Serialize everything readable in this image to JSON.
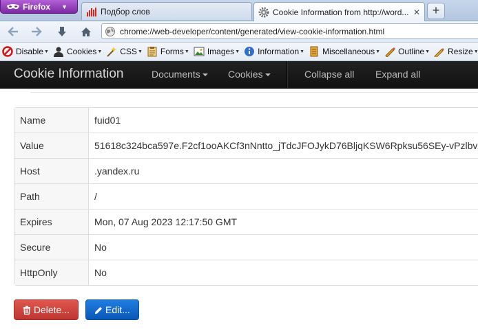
{
  "browser": {
    "app_button": "Firefox",
    "tabs": [
      {
        "title": "Подбор слов",
        "active": false
      },
      {
        "title": "Cookie Information from http://word...",
        "active": true
      }
    ],
    "url": "chrome://web-developer/content/generated/view-cookie-information.html"
  },
  "webdev_toolbar": [
    {
      "label": "Disable",
      "icon": "disable-icon"
    },
    {
      "label": "Cookies",
      "icon": "cookies-icon"
    },
    {
      "label": "CSS",
      "icon": "css-icon"
    },
    {
      "label": "Forms",
      "icon": "forms-icon"
    },
    {
      "label": "Images",
      "icon": "images-icon"
    },
    {
      "label": "Information",
      "icon": "information-icon"
    },
    {
      "label": "Miscellaneous",
      "icon": "miscellaneous-icon"
    },
    {
      "label": "Outline",
      "icon": "outline-icon"
    },
    {
      "label": "Resize",
      "icon": "resize-icon"
    }
  ],
  "page_nav": {
    "brand": "Cookie Information",
    "documents": "Documents",
    "cookies": "Cookies",
    "collapse_all": "Collapse all",
    "expand_all": "Expand all"
  },
  "cookie": {
    "rows": [
      {
        "label": "Name",
        "value": "fuid01"
      },
      {
        "label": "Value",
        "value": "51618c324bca597e.F2cf1ooAKCf3nNntto_jTdcJFOJykD76BljqKSW6Rpksu56SEy-vPzlbv"
      },
      {
        "label": "Host",
        "value": ".yandex.ru"
      },
      {
        "label": "Path",
        "value": "/"
      },
      {
        "label": "Expires",
        "value": "Mon, 07 Aug 2023 12:17:50 GMT"
      },
      {
        "label": "Secure",
        "value": "No"
      },
      {
        "label": "HttpOnly",
        "value": "No"
      }
    ]
  },
  "actions": {
    "delete": "Delete...",
    "edit": "Edit..."
  },
  "colors": {
    "navbar_bg": "#1b1b1b",
    "delete_btn": "#cf4740",
    "edit_btn": "#126ad0",
    "firefox_btn": "#9543bd"
  }
}
